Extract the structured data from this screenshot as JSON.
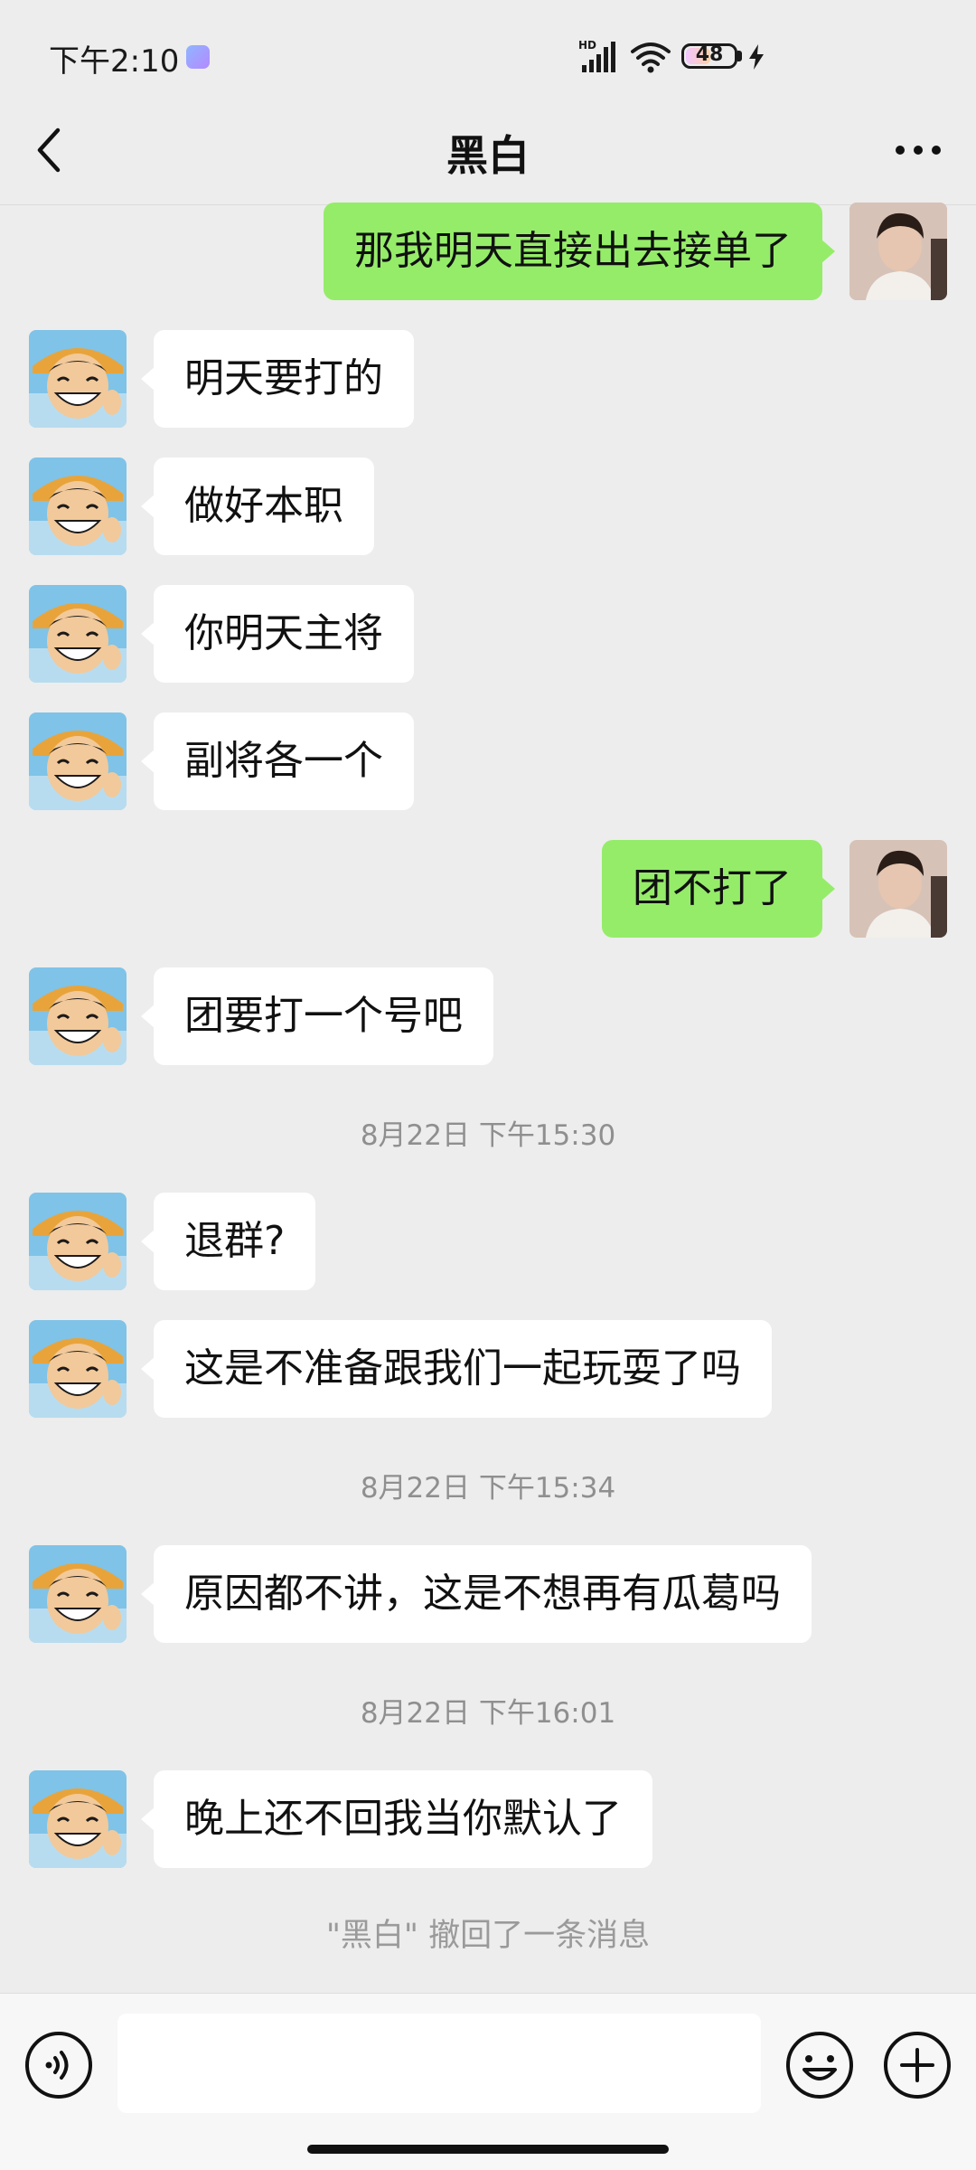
{
  "status_bar": {
    "time": "下午2:10",
    "battery": "48",
    "network": "HD"
  },
  "header": {
    "title": "黑白"
  },
  "messages": [
    {
      "text": "那我明天直接出去接单了"
    },
    {
      "text": "明天要打的"
    },
    {
      "text": "做好本职"
    },
    {
      "text": "你明天主将"
    },
    {
      "text": "副将各一个"
    },
    {
      "text": "团不打了"
    },
    {
      "text": "团要打一个号吧"
    },
    {
      "text": "退群?"
    },
    {
      "text": "这是不准备跟我们一起玩耍了吗"
    },
    {
      "text": "原因都不讲，这是不想再有瓜葛吗"
    },
    {
      "text": "晚上还不回我当你默认了"
    }
  ],
  "timestamps": [
    "8月22日 下午15:30",
    "8月22日 下午15:34",
    "8月22日 下午16:01"
  ],
  "system_notice": "\"黑白\" 撤回了一条消息",
  "input": {
    "value": "",
    "placeholder": ""
  },
  "colors": {
    "background": "#ededed",
    "outgoing_bubble": "#95ec69",
    "incoming_bubble": "#ffffff",
    "timestamp_text": "#8f8f8f"
  },
  "icons": {
    "back": "chevron-left-icon",
    "more": "more-dots-icon",
    "voice": "voice-icon",
    "emoji": "emoji-icon",
    "plus": "plus-icon"
  }
}
